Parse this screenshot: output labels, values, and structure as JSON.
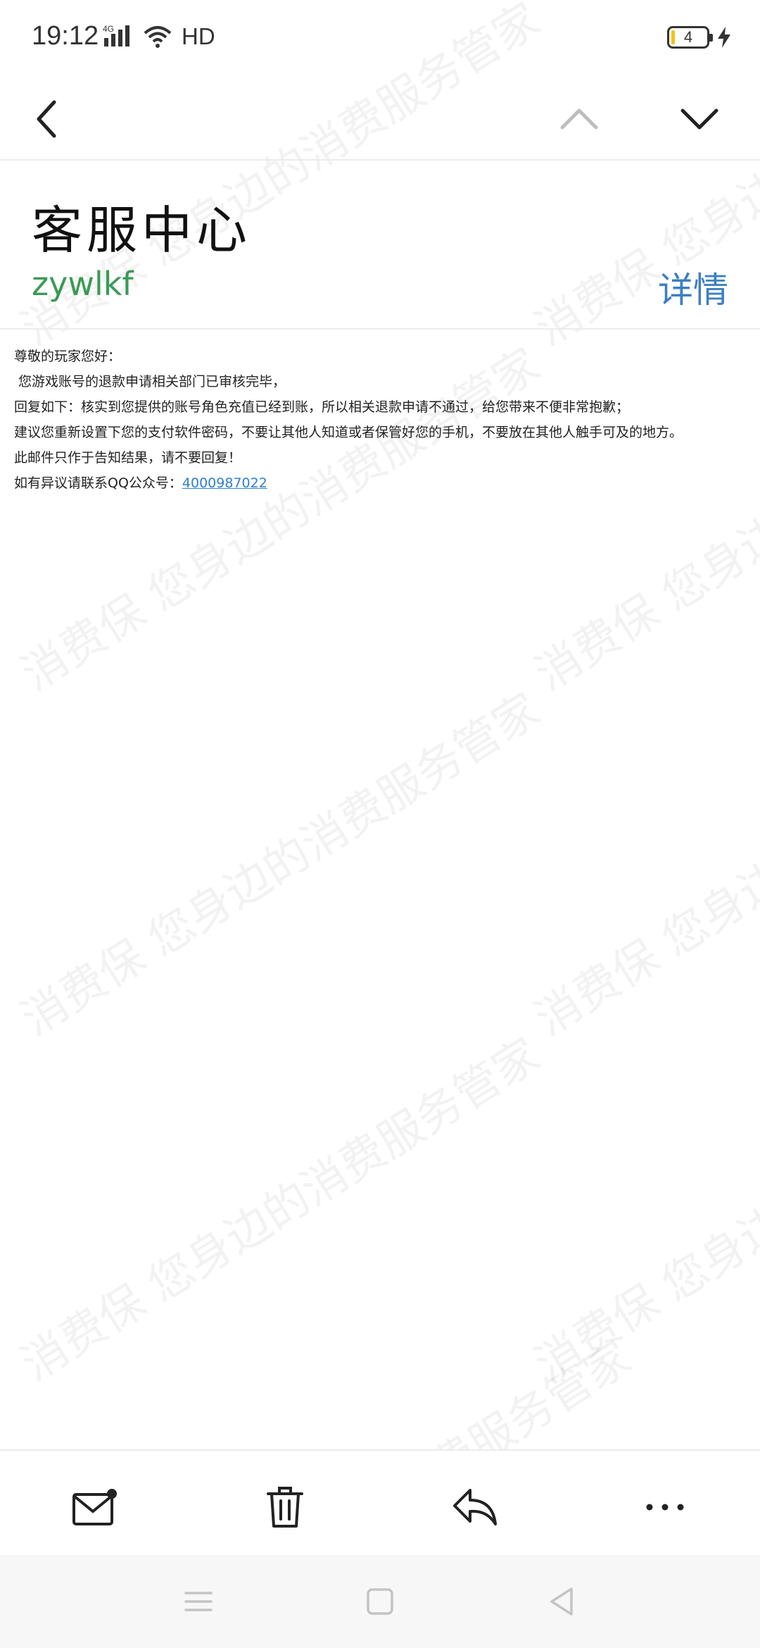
{
  "status_bar": {
    "time": "19:12",
    "network": "4G",
    "hd": "HD",
    "battery": "4"
  },
  "header": {
    "sender_name": "客服中心",
    "sender_id": "zywlkf",
    "details_label": "详情"
  },
  "body": {
    "lines": [
      "尊敬的玩家您好：",
      "您游戏账号的退款申请相关部门已审核完毕，",
      "回复如下：核实到您提供的账号角色充值已经到账，所以相关退款申请不通过，给您带来不便非常抱歉；",
      "建议您重新设置下您的支付软件密码，不要让其他人知道或者保管好您的手机，不要放在其他人触手可及的地方。",
      "此邮件只作于告知结果，请不要回复！"
    ],
    "qq_prefix": "如有异议请联系QQ公众号：",
    "qq_number": "4000987022"
  },
  "watermark": {
    "text_a": "消费保 您身边的消费服务管家",
    "text_b": "消费保 您身边"
  },
  "icons": {
    "back": "chevron-left-icon",
    "prev": "chevron-up-icon",
    "next": "chevron-down-icon",
    "unread": "mail-unread-icon",
    "delete": "trash-icon",
    "reply": "reply-icon",
    "more": "more-icon"
  },
  "colors": {
    "sender_id": "#3a9a55",
    "link": "#3d7fc1",
    "qq_link": "#2f7fd1"
  }
}
